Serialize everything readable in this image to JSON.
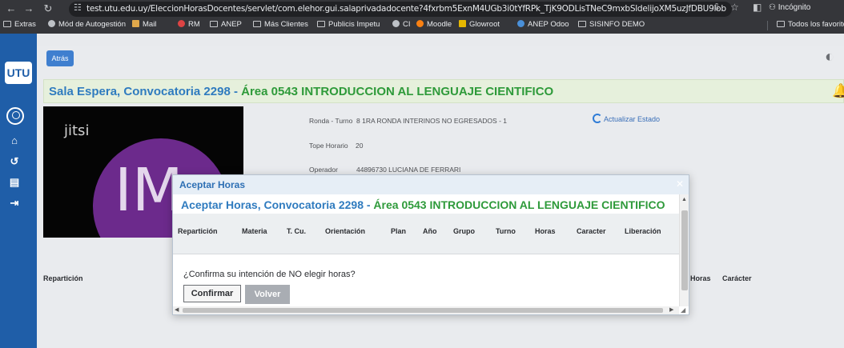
{
  "browser": {
    "url": "test.utu.edu.uy/EleccionHorasDocentes/servlet/com.elehor.gui.salaprivadadocente?4fxrbm5ExnM4UGb3i0tYfRPk_TjK9ODLisTNeC9mxbSldelijoXM5uzJfDBU9lob",
    "incognito_label": "Incógnito",
    "bookmarks": [
      {
        "label": "Extras",
        "icon": "folder-icon"
      },
      {
        "label": "Mód de Autogestión",
        "icon": "gear-icon"
      },
      {
        "label": "Mail",
        "icon": "mail-icon"
      },
      {
        "label": "RM",
        "icon": "rm-icon"
      },
      {
        "label": "ANEP",
        "icon": "folder-icon"
      },
      {
        "label": "Más Clientes",
        "icon": "folder-icon"
      },
      {
        "label": "Publicis Impetu",
        "icon": "folder-icon"
      },
      {
        "label": "CI",
        "icon": "gear-icon"
      },
      {
        "label": "Moodle",
        "icon": "moodle-icon"
      },
      {
        "label": "Glowroot",
        "icon": "glowroot-icon"
      },
      {
        "label": "ANEP Odoo",
        "icon": "odoo-icon"
      },
      {
        "label": "SISINFO DEMO",
        "icon": "folder-icon"
      }
    ],
    "all_bookmarks_label": "Todos los favoritos"
  },
  "sidebar": {
    "logo_text": "UTU",
    "icons": [
      "user-circle-icon",
      "home-icon",
      "history-icon",
      "document-icon",
      "logout-icon"
    ]
  },
  "main": {
    "back_label": "Atrás",
    "title_part1": "Sala Espera, Convocatoria 2298 - ",
    "title_part2": "Área 0543 INTRODUCCION AL LENGUAJE CIENTIFICO",
    "video": {
      "brand": "jitsi",
      "avatar_initials": "IM"
    },
    "info": {
      "ronda_label": "Ronda - Turno",
      "ronda_value": "8 1RA  RONDA INTERINOS NO EGRESADOS - 1",
      "tope_label": "Tope Horario",
      "tope_value": "20",
      "operador_label": "Operador",
      "operador_value": "44896730 LUCIANA DE FERRARI"
    },
    "refresh_label": "Actualizar Estado",
    "table_headers": {
      "reparticion": "Repartición",
      "horas": "Horas",
      "caracter": "Carácter"
    }
  },
  "modal": {
    "header_title": "Aceptar Horas",
    "title_part1": "Aceptar Horas, Convocatoria 2298 - ",
    "title_part2": "Área 0543 INTRODUCCION AL LENGUAJE CIENTIFICO",
    "columns": [
      "Repartición",
      "Materia",
      "T. Cu.",
      "Orientación",
      "Plan",
      "Año",
      "Grupo",
      "Turno",
      "Horas",
      "Caracter",
      "Liberación"
    ],
    "confirm_question": "¿Confirma su intención de NO elegir horas?",
    "confirm_button": "Confirmar",
    "back_button": "Volver"
  },
  "colors": {
    "sidebar": "#1f5ea8",
    "title_blue": "#2f7bbf",
    "title_green": "#2e9a3a",
    "avatar": "#6c2a8c"
  }
}
